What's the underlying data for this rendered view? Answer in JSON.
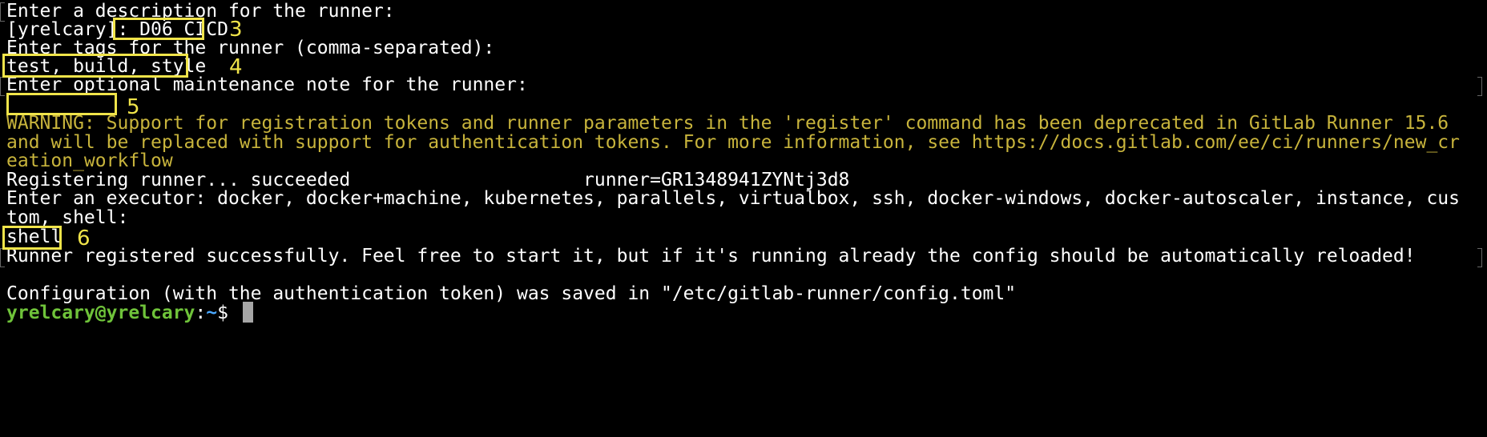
{
  "terminal": {
    "lines": {
      "l1": "Enter a description for the runner:",
      "l2_prefix": "[yrelcary]: ",
      "l2_value": "D06_CICD",
      "l3": "Enter tags for the runner (comma-separated):",
      "l4": "test, build, style",
      "l5": "Enter optional maintenance note for the runner:",
      "l6": "",
      "l7": "WARNING: Support for registration tokens and runner parameters in the 'register' command has been deprecated in GitLab Runner 15.6",
      "l8": "and will be replaced with support for authentication tokens. For more information, see https://docs.gitlab.com/ee/ci/runners/new_cr",
      "l9": "eation_workflow",
      "l10": "Registering runner... succeeded                     runner=GR1348941ZYNtj3d8",
      "l11": "Enter an executor: docker, docker+machine, kubernetes, parallels, virtualbox, ssh, docker-windows, docker-autoscaler, instance, cus",
      "l12": "tom, shell:",
      "l13": "shell",
      "l14": "Runner registered successfully. Feel free to start it, but if it's running already the config should be automatically reloaded!",
      "l15": "",
      "l16": "Configuration (with the authentication token) was saved in \"/etc/gitlab-runner/config.toml\""
    },
    "prompt": {
      "user_host": "yrelcary@yrelcary",
      "separator": ":",
      "path": "~",
      "symbol": "$ "
    }
  },
  "annotations": {
    "n3": "3",
    "n4": "4",
    "n5": "5",
    "n6": "6"
  },
  "colors": {
    "background": "#000000",
    "text": "#ffffff",
    "warning": "#c8b43c",
    "prompt_user": "#6fc33a",
    "prompt_path": "#4aa8ff",
    "annotation": "#f0e44a"
  }
}
